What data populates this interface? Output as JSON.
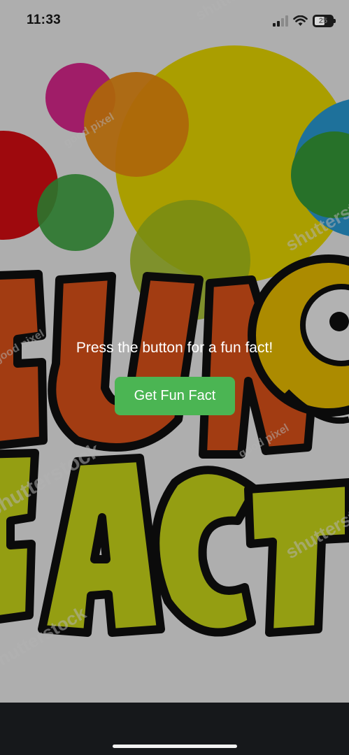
{
  "status_bar": {
    "time": "11:33",
    "battery": "25",
    "icons": [
      "signal-icon",
      "wifi-icon",
      "battery-icon"
    ]
  },
  "background": {
    "logo_line1": "FUN",
    "logo_line2": "FACTS",
    "watermarks": [
      "good pixel",
      "shutterstock"
    ]
  },
  "main": {
    "prompt": "Press the button for a fun fact!",
    "button_label": "Get Fun Fact"
  },
  "colors": {
    "button": "#4bb553",
    "overlay": "rgba(0,0,0,0.30)",
    "bottom_bar": "#16181b"
  }
}
